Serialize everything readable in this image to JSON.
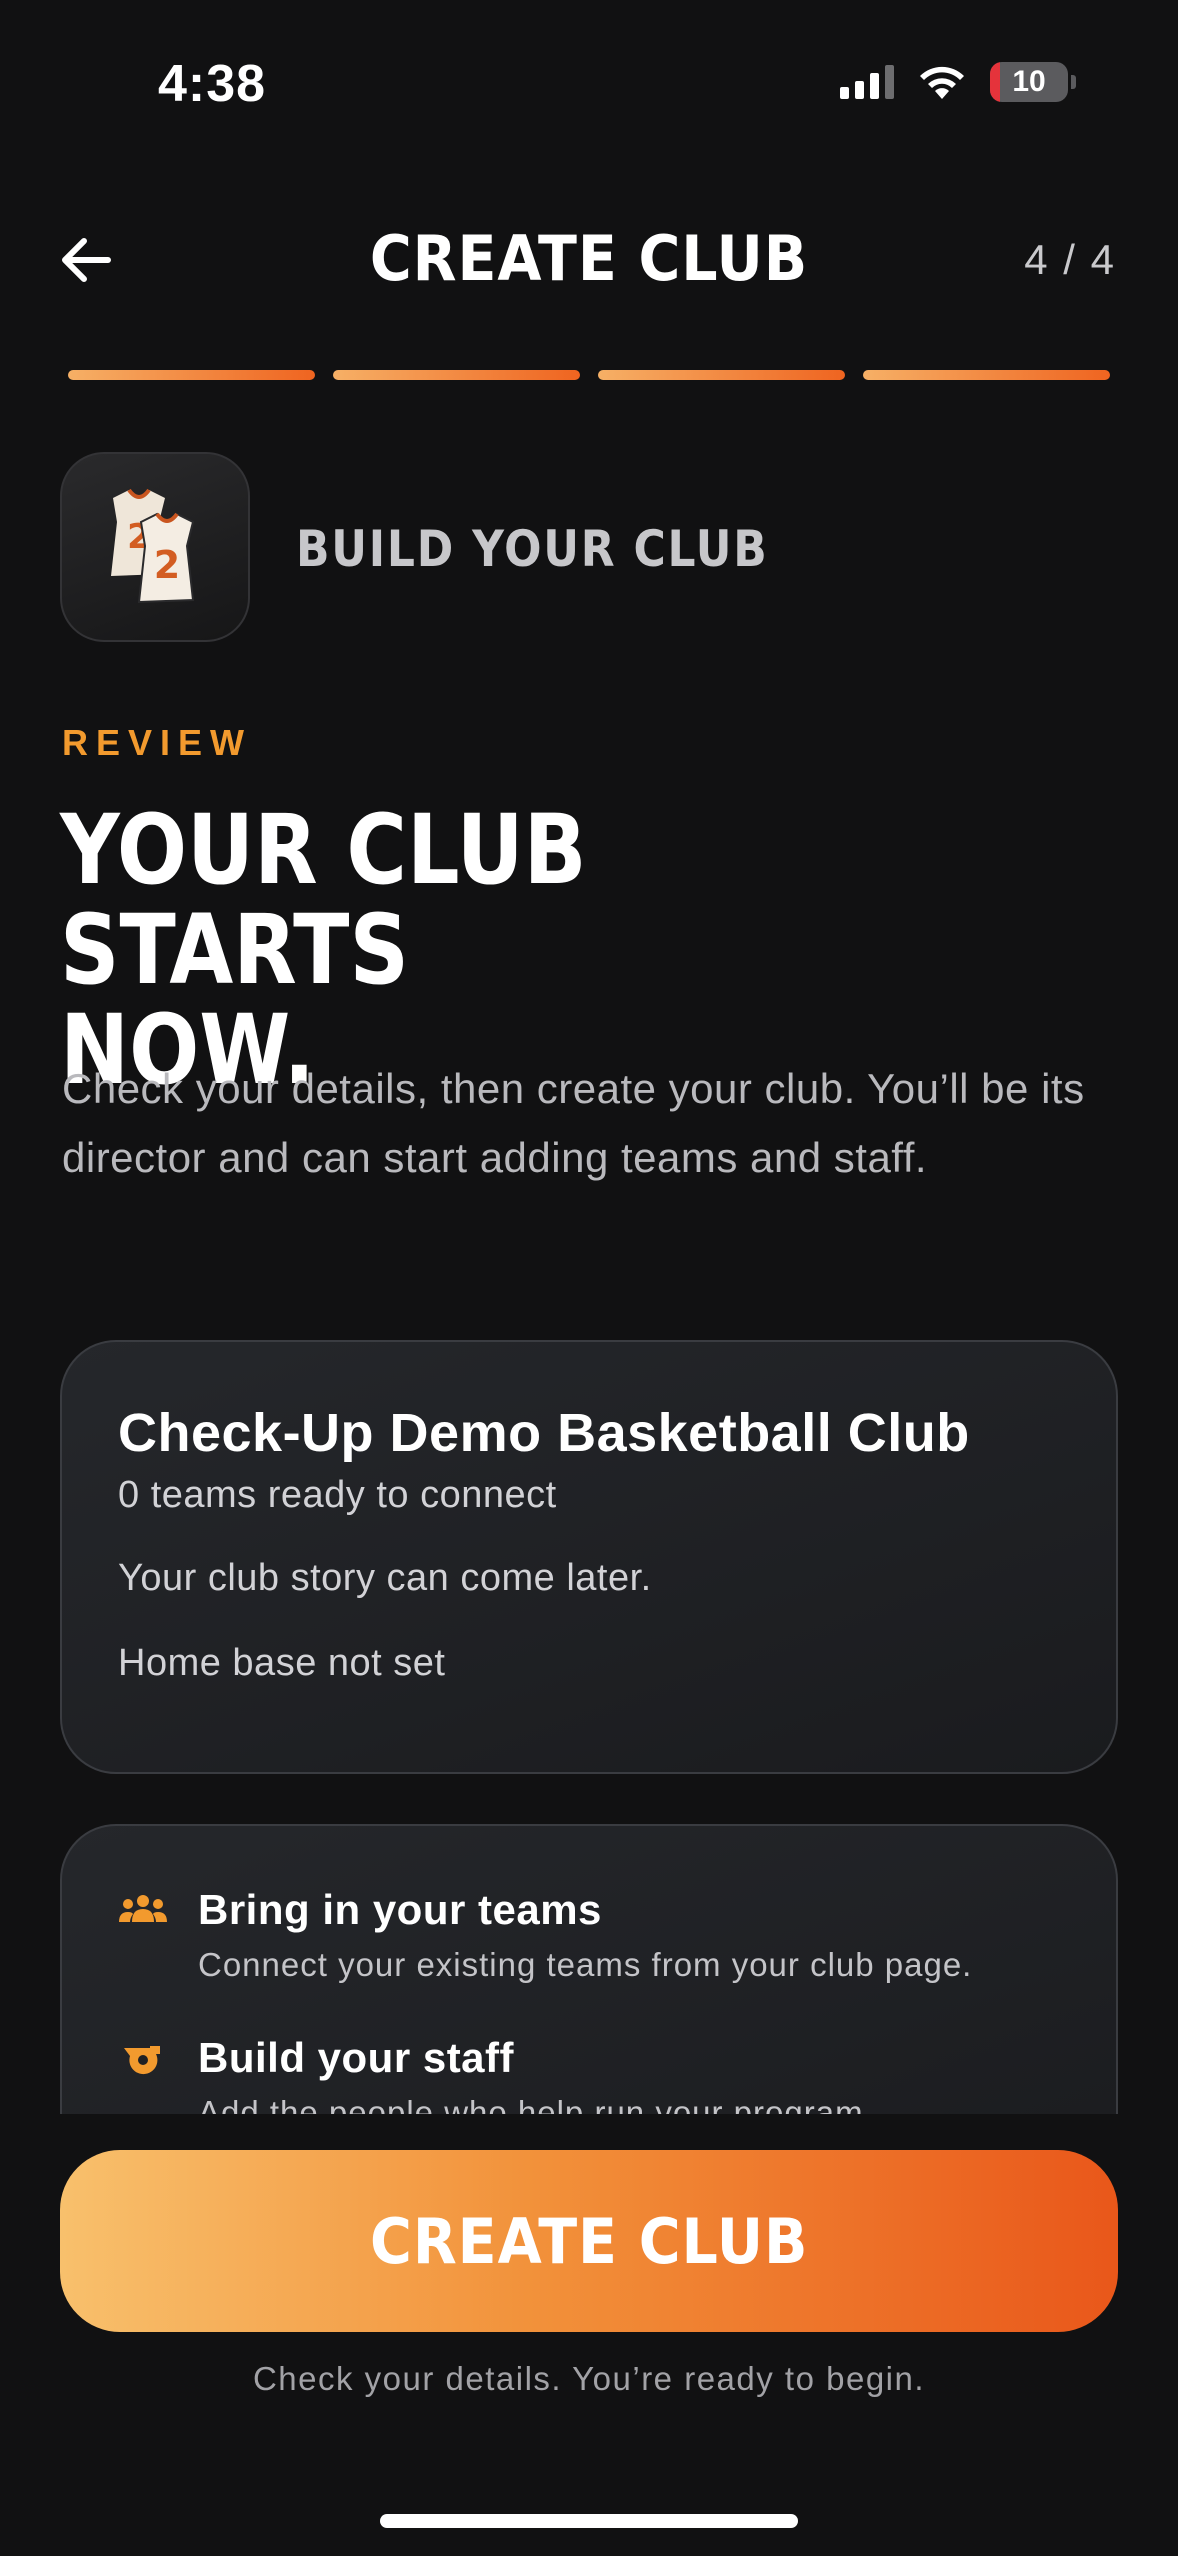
{
  "status_bar": {
    "time": "4:38",
    "battery": "10"
  },
  "header": {
    "title": "CREATE CLUB",
    "step": "4 / 4",
    "progress_steps_completed": 4,
    "progress_steps_total": 4
  },
  "club_badge": {
    "label": "BUILD YOUR CLUB",
    "jersey_numbers": [
      "2",
      "2"
    ]
  },
  "review": {
    "eyebrow": "REVIEW",
    "headline_line1": "YOUR CLUB STARTS",
    "headline_line2": "NOW.",
    "intro": "Check your details, then create your club. You’ll be its director and can start adding teams and staff."
  },
  "summary": {
    "club_name": "Check-Up Demo Basketball Club",
    "teams": "0 teams ready to connect",
    "story": "Your club story can come later.",
    "home_base": "Home base not set"
  },
  "next_steps": [
    {
      "icon": "people-icon",
      "title": "Bring in your teams",
      "desc": "Connect your existing teams from your club page."
    },
    {
      "icon": "whistle-icon",
      "title": "Build your staff",
      "desc": "Add the people who help run your program."
    }
  ],
  "cta": {
    "label": "CREATE CLUB",
    "note": "Check your details. You’re ready to begin."
  },
  "colors": {
    "accent": "#f29a2e",
    "gradient_start": "#f8c06c",
    "gradient_end": "#e9571a",
    "background": "#111112"
  }
}
